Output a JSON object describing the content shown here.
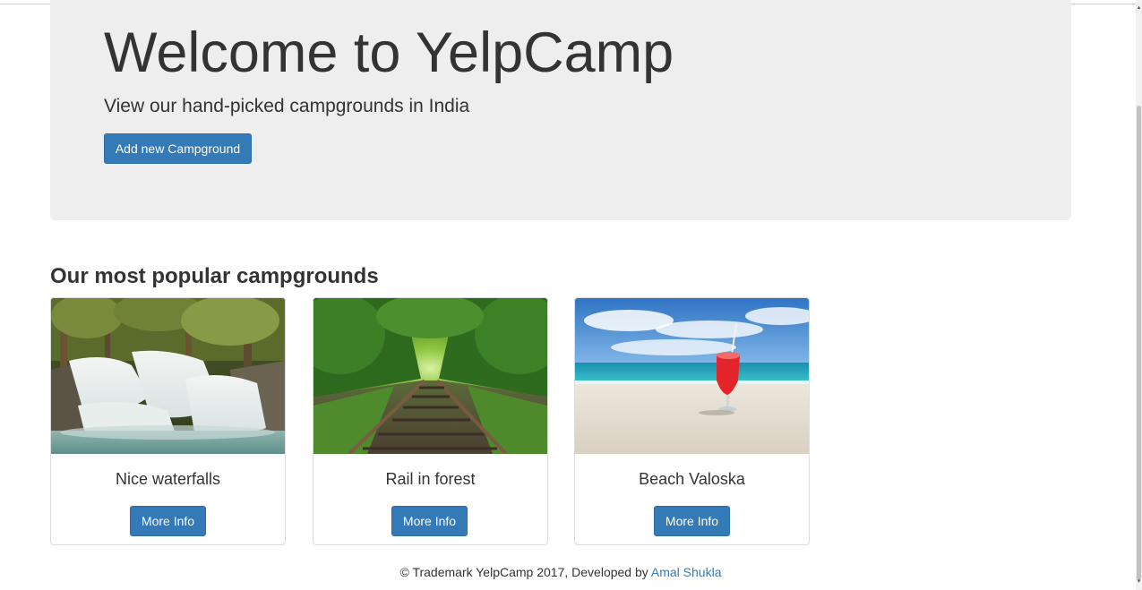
{
  "jumbotron": {
    "title": "Welcome to YelpCamp",
    "subtitle": "View our hand-picked campgrounds in India",
    "add_button_label": "Add new Campground"
  },
  "section": {
    "heading": "Our most popular campgrounds"
  },
  "campgrounds": [
    {
      "name": "Nice waterfalls",
      "button_label": "More Info",
      "image": "waterfall-photo"
    },
    {
      "name": "Rail in forest",
      "button_label": "More Info",
      "image": "forest-railway-photo"
    },
    {
      "name": "Beach Valoska",
      "button_label": "More Info",
      "image": "beach-drink-photo"
    }
  ],
  "footer": {
    "text": "© Trademark YelpCamp 2017, Developed by ",
    "author_link": "Amal Shukla"
  },
  "colors": {
    "primary": "#337ab7",
    "jumbotron_bg": "#eeeeee",
    "text": "#333333"
  }
}
